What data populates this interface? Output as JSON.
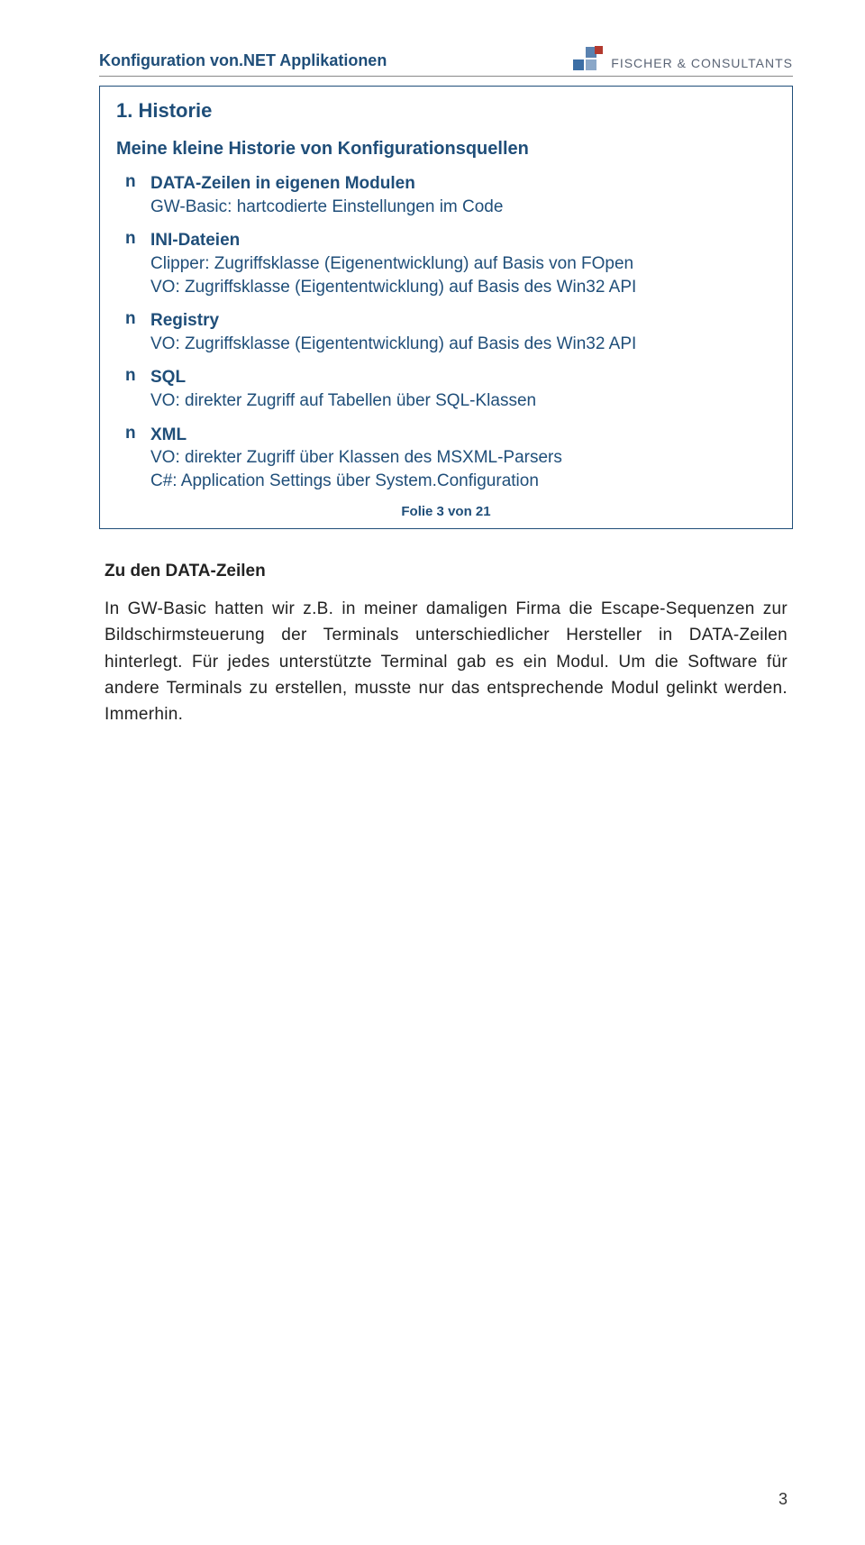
{
  "header": {
    "title": "Konfiguration von.NET Applikationen",
    "company": "FISCHER & CONSULTANTS"
  },
  "slide": {
    "heading": "1. Historie",
    "subheading": "Meine kleine Historie von Konfigurationsquellen",
    "bullets": [
      {
        "label": "DATA-Zeilen in eigenen Modulen",
        "desc": "GW-Basic: hartcodierte Einstellungen im Code"
      },
      {
        "label": "INI-Dateien",
        "desc": "Clipper: Zugriffsklasse (Eigenentwicklung) auf Basis von FOpen\nVO: Zugriffsklasse (Eigententwicklung) auf Basis des Win32 API"
      },
      {
        "label": "Registry",
        "desc": "VO: Zugriffsklasse (Eigententwicklung) auf Basis des Win32 API"
      },
      {
        "label": "SQL",
        "desc": "VO: direkter Zugriff auf Tabellen über SQL-Klassen"
      },
      {
        "label": "XML",
        "desc": "VO: direkter Zugriff über Klassen des MSXML-Parsers\nC#: Application Settings über System.Configuration"
      }
    ],
    "footer": "Folie 3 von 21"
  },
  "body": {
    "heading": "Zu den DATA-Zeilen",
    "paragraphs": [
      "In GW-Basic hatten wir z.B. in meiner damaligen Firma die Escape-Sequenzen zur Bildschirmsteuerung der Terminals unterschiedlicher Hersteller in DATA-Zeilen hinterlegt. Für jedes unterstützte Terminal gab es ein Modul. Um die Software für andere Terminals zu erstellen, musste nur das entsprechende Modul gelinkt werden. Immerhin."
    ]
  },
  "page_number": "3",
  "bullet_char": "n"
}
